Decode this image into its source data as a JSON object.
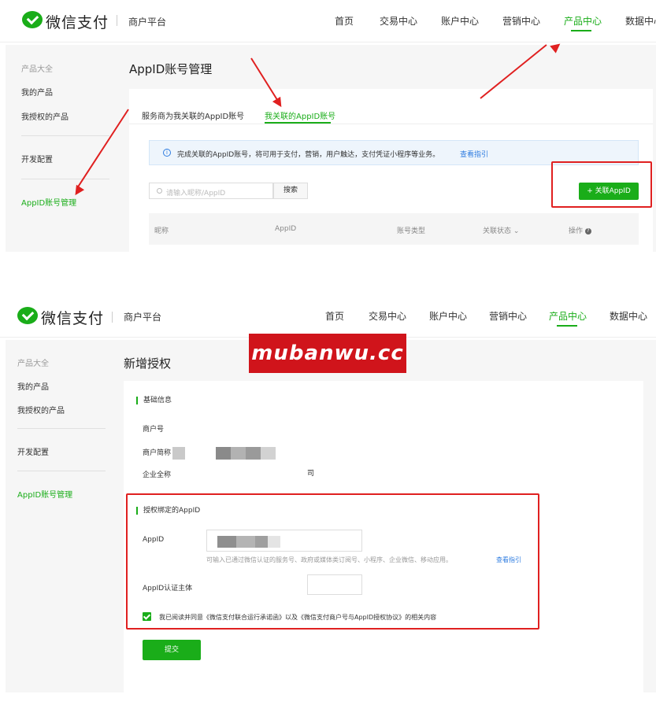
{
  "colors": {
    "brand": "#1aad19",
    "annotation": "#e02020",
    "link": "#2e7ce0",
    "watermark": "#d0141b"
  },
  "header": {
    "logo_text": "微信支付",
    "subtitle": "商户平台",
    "nav": [
      "首页",
      "交易中心",
      "账户中心",
      "营销中心",
      "产品中心",
      "数据中心"
    ],
    "active_nav": "产品中心"
  },
  "sidebar": {
    "group_title": "产品大全",
    "items": [
      "我的产品",
      "我授权的产品",
      "开发配置",
      "AppID账号管理"
    ],
    "active_item": "AppID账号管理"
  },
  "screen1": {
    "page_title": "AppID账号管理",
    "tabs": [
      "服务商为我关联的AppID账号",
      "我关联的AppID账号"
    ],
    "active_tab": "我关联的AppID账号",
    "info_text": "完成关联的AppID账号，将可用于支付，营销，用户触达，支付凭证小程序等业务。",
    "info_link": "查看指引",
    "search_placeholder": "请输入昵称/AppID",
    "search_button": "搜索",
    "add_button": "+ 关联AppID",
    "columns": [
      "昵称",
      "AppID",
      "账号类型",
      "关联状态",
      "操作"
    ],
    "status_sort_icon": "chevron-down-icon",
    "operation_help_icon": "question-icon"
  },
  "screen2": {
    "page_title": "新增授权",
    "basic_section_title": "基础信息",
    "merchant_no_label": "商户号",
    "merchant_short_label": "商户简称",
    "company_name_label": "企业全称",
    "company_name_suffix": "司",
    "appid_section_title": "授权绑定的AppID",
    "appid_label": "AppID",
    "appid_hint": "可输入已通过微信认证的服务号、政府或媒体类订阅号、小程序、企业微信、移动应用。",
    "appid_hint_link": "查看指引",
    "appid_entity_label": "AppID认证主体",
    "agreement_text": "我已阅读并同意《微信支付联合运行承诺函》以及《微信支付商户号与AppID授权协议》的相关内容",
    "agreement_checked": true,
    "submit_button": "提交"
  },
  "watermark": {
    "text": "mubanwu.cc"
  }
}
